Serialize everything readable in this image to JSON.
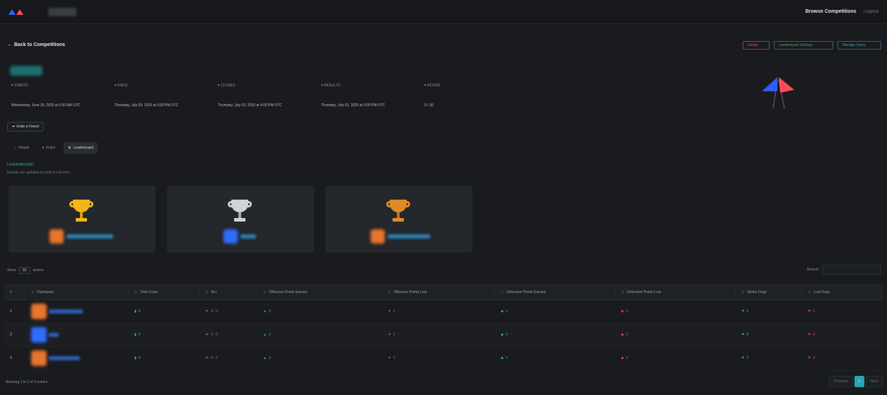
{
  "navbar": {
    "browse_label": "Browse Competitions",
    "logout_label": "Logout"
  },
  "back_label": "Back to Competitions",
  "actions": {
    "leave_label": "Delete",
    "join_label": "Leaderboard Settings",
    "submit_label": "Manage Users"
  },
  "meta": [
    {
      "label": "STARTS",
      "value": "Wednesday, June 25, 2025 at 2:00 AM UTC",
      "icon": "calendar-icon"
    },
    {
      "label": "ENDS",
      "value": "Thursday, July 03, 2025 at 5:00 PM UTC",
      "icon": "calendar-icon"
    },
    {
      "label": "CLOSES",
      "value": "Thursday, July 03, 2025 at 4:00 PM UTC",
      "icon": "calendar-icon"
    },
    {
      "label": "RESULTS",
      "value": "Thursday, July 03, 2025 at 5:00 PM UTC",
      "icon": "calendar-icon"
    },
    {
      "label": "ROUND",
      "value": "0 / 30",
      "icon": "round-icon"
    }
  ],
  "invite_label": "Invite a Friend",
  "tabs": [
    {
      "label": "Details",
      "icon": "home-icon"
    },
    {
      "label": "Rules",
      "icon": "rules-icon"
    },
    {
      "label": "Leaderboard",
      "icon": "trophy-icon"
    }
  ],
  "leaderboard": {
    "heading": "LEADERBOARD",
    "sub": "Results are updated at most in real time."
  },
  "podium_colors": {
    "gold": "#f2b51c",
    "silver": "#cfd2d6",
    "bronze": "#e08a2a"
  },
  "table_controls": {
    "show_label": "Show",
    "entries_value": "10",
    "entries_label": "entries",
    "search_label": "Search:"
  },
  "table": {
    "headers": [
      "#",
      "Participant",
      "Total Score",
      "W-L",
      "Offensive Points Earned",
      "Offensive Points Lost",
      "Defensive Points Earned",
      "Defensive Points Lost",
      "Stolen Flags",
      "Lost Flags"
    ],
    "rows": [
      {
        "rank": "1",
        "total": "0",
        "wl": "0 - 0",
        "off_earned": "0",
        "off_lost": "0",
        "def_earned": "0",
        "def_lost": "0",
        "stolen": "0",
        "lost": "0",
        "avatar": "#e8742e"
      },
      {
        "rank": "2",
        "total": "0",
        "wl": "0 - 0",
        "off_earned": "0",
        "off_lost": "0",
        "def_earned": "0",
        "def_lost": "0",
        "stolen": "0",
        "lost": "0",
        "avatar": "#2f6dff"
      },
      {
        "rank": "3",
        "total": "0",
        "wl": "0 - 0",
        "off_earned": "0",
        "off_lost": "0",
        "def_earned": "0",
        "def_lost": "0",
        "stolen": "0",
        "lost": "0",
        "avatar": "#e8742e"
      }
    ]
  },
  "table_info": "Showing 1 to 3 of 3 entries",
  "pagination": {
    "prev_label": "Previous",
    "current": "1",
    "next_label": "Next"
  }
}
